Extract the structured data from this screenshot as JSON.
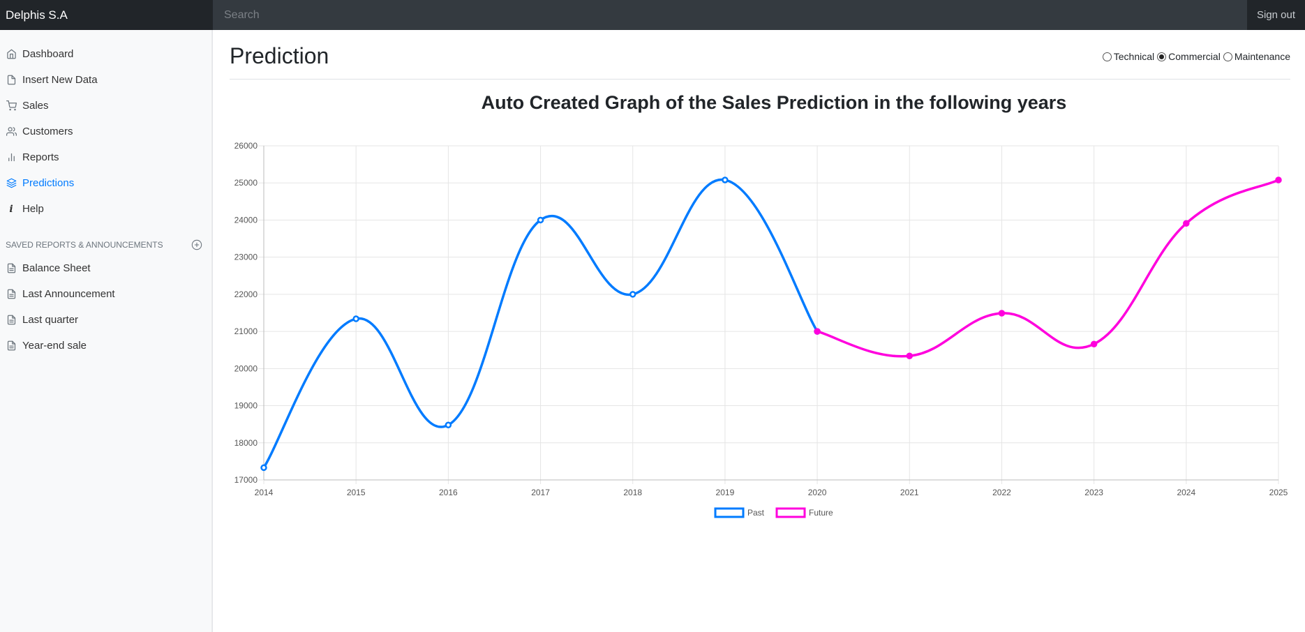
{
  "header": {
    "brand": "Delphis S.A",
    "search_placeholder": "Search",
    "signout_label": "Sign out"
  },
  "sidebar": {
    "items": [
      {
        "label": "Dashboard",
        "icon": "home-icon"
      },
      {
        "label": "Insert New Data",
        "icon": "file-icon"
      },
      {
        "label": "Sales",
        "icon": "cart-icon"
      },
      {
        "label": "Customers",
        "icon": "users-icon"
      },
      {
        "label": "Reports",
        "icon": "bar-chart-icon"
      },
      {
        "label": "Predictions",
        "icon": "layers-icon",
        "active": true
      },
      {
        "label": "Help",
        "icon": "info-icon"
      }
    ],
    "section_title": "SAVED REPORTS & ANNOUNCEMENTS",
    "saved": [
      {
        "label": "Balance Sheet",
        "icon": "file-text-icon"
      },
      {
        "label": "Last Announcement",
        "icon": "file-text-icon"
      },
      {
        "label": "Last quarter",
        "icon": "file-text-icon"
      },
      {
        "label": "Year-end sale",
        "icon": "file-text-icon"
      }
    ]
  },
  "main": {
    "title": "Prediction",
    "radios": [
      {
        "label": "Technical",
        "checked": false
      },
      {
        "label": "Commercial",
        "checked": true
      },
      {
        "label": "Maintenance",
        "checked": false
      }
    ]
  },
  "colors": {
    "past": "#007bff",
    "future": "#ff00dd"
  },
  "chart_data": {
    "type": "line",
    "title": "Auto Created Graph of the Sales Prediction in the following years",
    "x": [
      "2014",
      "2015",
      "2016",
      "2017",
      "2018",
      "2019",
      "2020",
      "2021",
      "2022",
      "2023",
      "2024",
      "2025"
    ],
    "ylim": [
      17000,
      26000
    ],
    "yticks": [
      17000,
      18000,
      19000,
      20000,
      21000,
      22000,
      23000,
      24000,
      25000,
      26000
    ],
    "grid": true,
    "legend": "bottom",
    "series": [
      {
        "name": "Past",
        "x": [
          "2014",
          "2015",
          "2016",
          "2017",
          "2018",
          "2019",
          "2020"
        ],
        "values": [
          17330,
          21340,
          18480,
          24000,
          22000,
          25080,
          21000
        ]
      },
      {
        "name": "Future",
        "x": [
          "2020",
          "2021",
          "2022",
          "2023",
          "2024",
          "2025"
        ],
        "values": [
          21000,
          20340,
          21490,
          20660,
          23910,
          25080
        ]
      }
    ]
  }
}
